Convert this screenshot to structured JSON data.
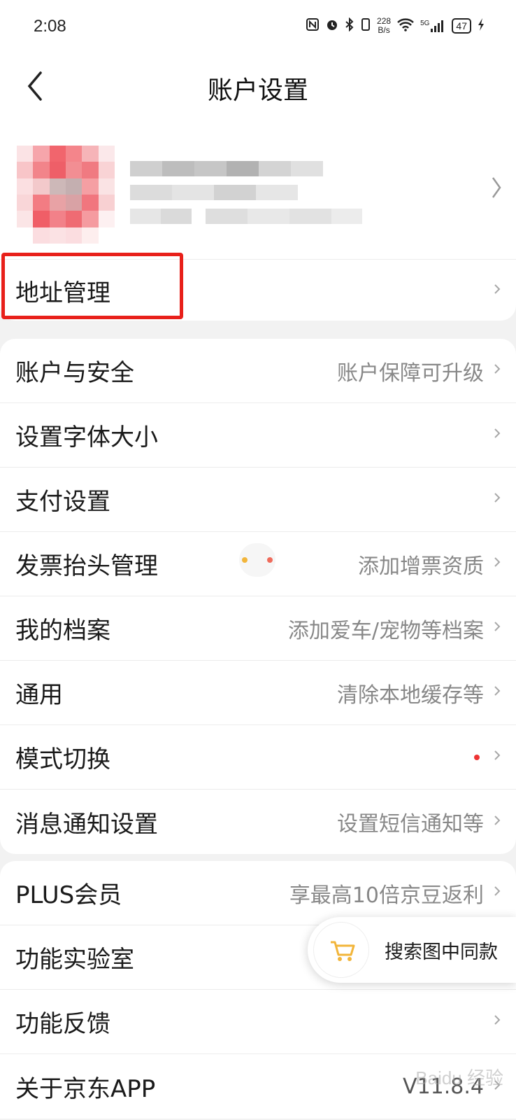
{
  "status_bar": {
    "time": "2:08",
    "net_speed_value": "228",
    "net_speed_unit": "B/s",
    "signal_label": "5G",
    "battery": "47"
  },
  "nav": {
    "title": "账户设置"
  },
  "address_row": {
    "label": "地址管理"
  },
  "settings_group": [
    {
      "label": "账户与安全",
      "hint": "账户保障可升级"
    },
    {
      "label": "设置字体大小",
      "hint": ""
    },
    {
      "label": "支付设置",
      "hint": ""
    },
    {
      "label": "发票抬头管理",
      "hint": "添加增票资质"
    },
    {
      "label": "我的档案",
      "hint": "添加爱车/宠物等档案"
    },
    {
      "label": "通用",
      "hint": "清除本地缓存等"
    },
    {
      "label": "模式切换",
      "hint": ""
    },
    {
      "label": "消息通知设置",
      "hint": "设置短信通知等"
    }
  ],
  "extra_group": [
    {
      "label": "PLUS会员",
      "hint": "享最高10倍京豆返利"
    },
    {
      "label": "功能实验室",
      "hint": ""
    },
    {
      "label": "功能反馈",
      "hint": ""
    },
    {
      "label": "关于京东APP",
      "hint": "V11.8.4"
    }
  ],
  "floating": {
    "label": "搜索图中同款"
  },
  "watermark": "Baidu 经验",
  "colors": {
    "highlight": "#e8201a",
    "accent_dot": "#e33333",
    "cart_icon": "#f2b53a"
  }
}
